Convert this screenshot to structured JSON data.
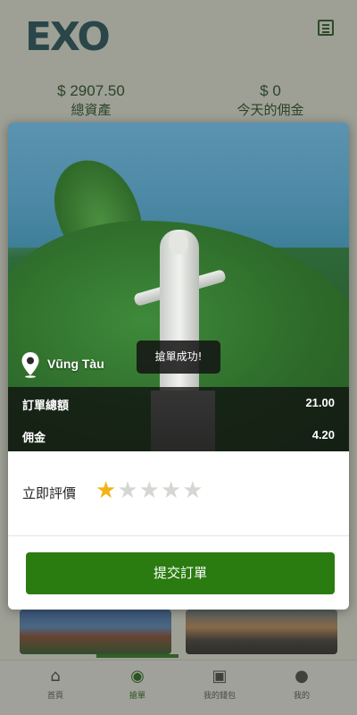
{
  "header": {
    "logo_text": "EXO",
    "menu_icon": "list-icon"
  },
  "stats": {
    "total_assets_value": "$ 2907.50",
    "total_assets_label": "總資產",
    "today_commission_value": "$ 0",
    "today_commission_label": "今天的佣金"
  },
  "modal": {
    "location_icon": "map-pin-icon",
    "location_name": "Vũng Tàu",
    "toast_message": "搶單成功!",
    "order_total_label": "訂單總額",
    "order_total_value": "21.00",
    "commission_label": "佣金",
    "commission_value": "4.20",
    "rating_label": "立即評價",
    "rating_value": 1,
    "rating_max": 5,
    "submit_label": "提交訂單"
  },
  "bottom_nav": {
    "items": [
      {
        "label": "首頁",
        "icon": "home-icon"
      },
      {
        "label": "搶單",
        "icon": "grab-order-icon"
      },
      {
        "label": "我的錢包",
        "icon": "wallet-icon"
      },
      {
        "label": "我的",
        "icon": "user-icon"
      }
    ],
    "active_index": 1
  },
  "colors": {
    "accent": "#2a7b10",
    "star_active": "#f2b317",
    "star_inactive": "#d5d7d3"
  }
}
